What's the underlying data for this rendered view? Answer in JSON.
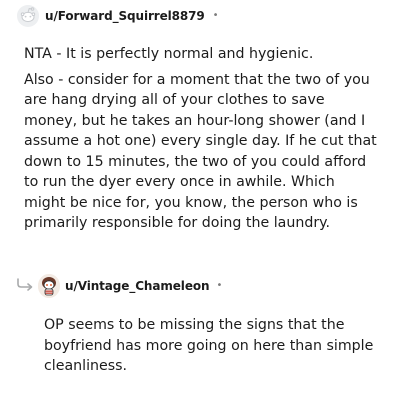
{
  "comment1": {
    "username": "u/Forward_Squirrel8879",
    "separator": "•",
    "avatar_icon": "snoo-outline-icon",
    "paragraphs": [
      "NTA - It is perfectly normal and hygienic.",
      "Also - consider for a moment that the two of you are hang drying all of your clothes to save money, but he takes an hour-long shower (and I assume a hot one) every single day. If he cut that down to 15 minutes, the two of you could afford to run the dyer every once in awhile. Which might be nice for, you know, the person who is primarily responsible for doing the laundry."
    ]
  },
  "reply": {
    "reply_icon": "reply-arrow-icon",
    "username": "u/Vintage_Chameleon",
    "separator": "•",
    "avatar_icon": "snoo-avatar-icon",
    "paragraphs": [
      "OP seems to be missing the signs that the boyfriend has more going on here than simple cleanliness."
    ]
  },
  "colors": {
    "text": "#1c1c1c",
    "muted": "#7c7c7c",
    "avatar_bg": "#edeff1"
  }
}
